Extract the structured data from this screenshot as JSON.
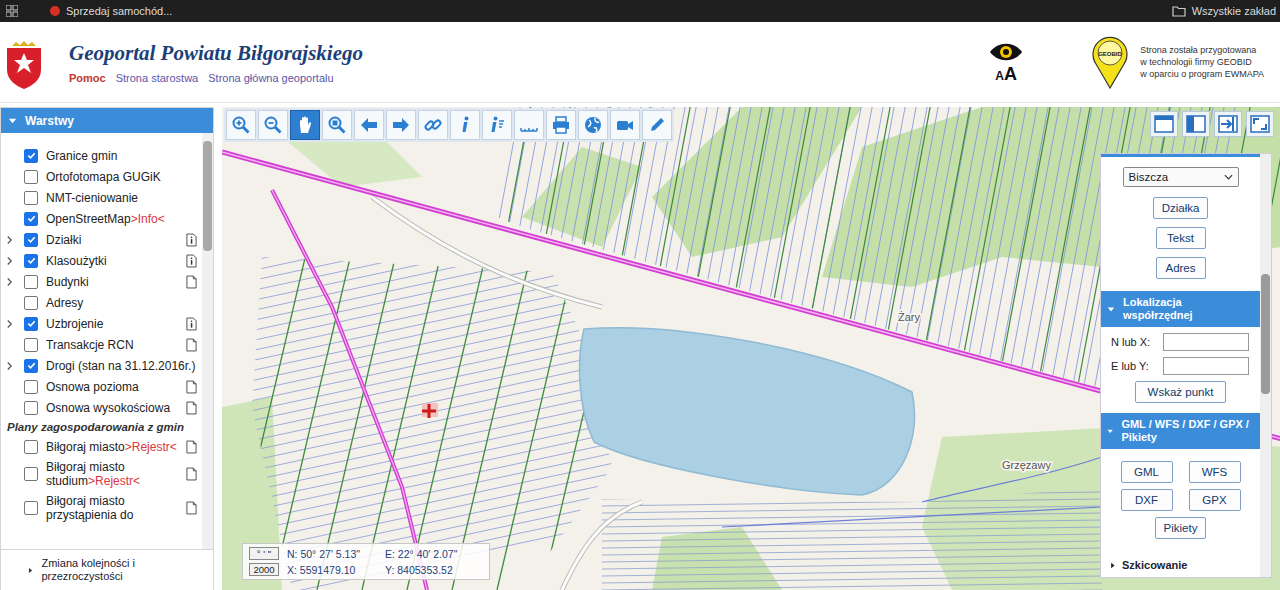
{
  "browser": {
    "tab_title": "Sprzedaj samochód...",
    "bookmarks": "Wszystkie zakład"
  },
  "header": {
    "title": "Geoportal Powiatu Biłgorajskiego",
    "links": [
      {
        "label": "Pomoc",
        "emphasis": true
      },
      {
        "label": "Strona starostwa",
        "emphasis": false
      },
      {
        "label": "Strona główna geoportalu",
        "emphasis": false
      }
    ],
    "font_small": "A",
    "font_large": "A",
    "vendor": {
      "logo": "GEOBID",
      "note_lines": [
        "Strona została przygotowana",
        "w technologii firmy GEOBID",
        "w oparciu o program EWMAPA"
      ]
    }
  },
  "layers_panel": {
    "title": "Warstwy",
    "expanded": true,
    "items": [
      {
        "kind": "layer",
        "label": "Granice gmin",
        "checked": true,
        "expandable": false,
        "icon": "none"
      },
      {
        "kind": "layer",
        "label": "Ortofotomapa GUGiK",
        "checked": false,
        "expandable": false,
        "icon": "none"
      },
      {
        "kind": "layer",
        "label": "NMT-cieniowanie",
        "checked": false,
        "expandable": false,
        "icon": "none"
      },
      {
        "kind": "layer",
        "label": "OpenStreetMap",
        "link": ">Info<",
        "checked": true,
        "expandable": false,
        "icon": "none"
      },
      {
        "kind": "layer",
        "label": "Działki",
        "checked": true,
        "expandable": true,
        "icon": "info"
      },
      {
        "kind": "layer",
        "label": "Klasoużytki",
        "checked": true,
        "expandable": true,
        "icon": "info"
      },
      {
        "kind": "layer",
        "label": "Budynki",
        "checked": false,
        "expandable": true,
        "icon": "doc"
      },
      {
        "kind": "layer",
        "label": "Adresy",
        "checked": false,
        "expandable": false,
        "icon": "none"
      },
      {
        "kind": "layer",
        "label": "Uzbrojenie",
        "checked": true,
        "expandable": true,
        "icon": "info"
      },
      {
        "kind": "layer",
        "label": "Transakcje RCN",
        "checked": false,
        "expandable": false,
        "icon": "doc"
      },
      {
        "kind": "layer",
        "label": "Drogi (stan na 31.12.2016r.)",
        "checked": true,
        "expandable": true,
        "icon": "none"
      },
      {
        "kind": "layer",
        "label": "Osnowa pozioma",
        "checked": false,
        "expandable": false,
        "icon": "doc"
      },
      {
        "kind": "layer",
        "label": "Osnowa wysokościowa",
        "checked": false,
        "expandable": false,
        "icon": "doc"
      },
      {
        "kind": "group",
        "label": "Plany zagospodarowania z gmin"
      },
      {
        "kind": "layer",
        "label": "Biłgoraj miasto",
        "link": ">Rejestr<",
        "checked": false,
        "expandable": false,
        "icon": "doc"
      },
      {
        "kind": "layer",
        "label": "Biłgoraj miasto studium",
        "link": ">Rejestr<",
        "checked": false,
        "expandable": false,
        "icon": "doc"
      },
      {
        "kind": "layer",
        "label": "Biłgoraj miasto przystąpienia do",
        "checked": false,
        "expandable": false,
        "icon": "doc"
      }
    ],
    "footer": "Zmiana kolejności i przezroczystości"
  },
  "toolbar": [
    {
      "kind": "zoom-in",
      "selected": false
    },
    {
      "kind": "zoom-out",
      "selected": false
    },
    {
      "kind": "pan",
      "selected": true
    },
    {
      "kind": "zoom-box",
      "selected": false
    },
    {
      "kind": "back",
      "selected": false
    },
    {
      "kind": "forward",
      "selected": false
    },
    {
      "kind": "link",
      "selected": false
    },
    {
      "kind": "info",
      "selected": false
    },
    {
      "kind": "query",
      "selected": false
    },
    {
      "kind": "measure",
      "selected": false
    },
    {
      "kind": "print",
      "selected": false
    },
    {
      "kind": "globe",
      "selected": false
    },
    {
      "kind": "camera",
      "selected": false
    },
    {
      "kind": "pencil",
      "selected": false
    }
  ],
  "view_buttons": [
    {
      "kind": "full"
    },
    {
      "kind": "split"
    },
    {
      "kind": "dock"
    },
    {
      "kind": "expand"
    }
  ],
  "search_panel": {
    "municipality": "Biszcza",
    "search_buttons": [
      "Działka",
      "Tekst",
      "Adres"
    ],
    "coordinate_section": {
      "title": "Lokalizacja współrzędnej",
      "expanded": true,
      "fields": [
        {
          "label": "N lub X:",
          "value": ""
        },
        {
          "label": "E lub Y:",
          "value": ""
        }
      ],
      "button": "Wskaż punkt"
    },
    "export_section": {
      "title": "GML / WFS / DXF / GPX / Pikiety",
      "expanded": true,
      "buttons": [
        "GML",
        "WFS",
        "DXF",
        "GPX"
      ],
      "wide_button": "Pikiety"
    },
    "sketch_section": {
      "title": "Szkicowanie",
      "expanded": false
    }
  },
  "coordinates": [
    {
      "system": "° ' \"",
      "first": "N: 50° 27' 5.13\"",
      "second": "E: 22° 40' 2.07\""
    },
    {
      "system": "2000",
      "first": "X: 5591479.10",
      "second": "Y: 8405353.52"
    }
  ],
  "map": {
    "place_labels": [
      "Żary",
      "Grzęzawy"
    ]
  }
}
